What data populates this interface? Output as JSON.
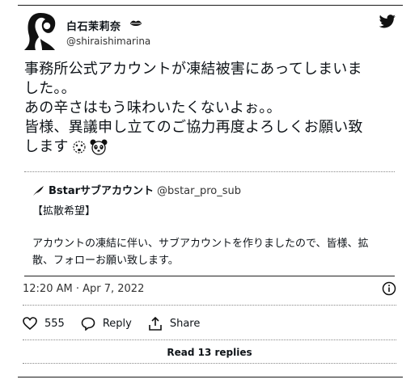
{
  "user": {
    "name": "白石茉莉奈",
    "handle": "@shiraishimarina"
  },
  "tweet": {
    "lines": [
      "事務所公式アカウントが凍結被害にあってしまいま",
      "した。。",
      "あの辛さはもう味わいたくないよぉ。。",
      "皆様、異議申し立てのご協力再度よろしくお願い致",
      "します"
    ]
  },
  "quote": {
    "name": "Bstarサブアカウント",
    "handle": "@bstar_pro_sub",
    "tag": "【拡散希望】",
    "body": "アカウントの凍結に伴い、サブアカウントを作りましたので、皆様、拡散、フォローお願い致します。"
  },
  "timestamp": "12:20 AM · Apr 7, 2022",
  "actions": {
    "likes": "555",
    "reply": "Reply",
    "share": "Share"
  },
  "replies_link": "Read 13 replies",
  "icons": {
    "avatar": "avatar-illustration",
    "verified": "lips-icon",
    "platform": "twitter-bird-icon",
    "info": "info-icon",
    "like": "heart-icon",
    "reply": "speech-bubble-icon",
    "share": "share-upload-icon",
    "quote_logo": "feather-icon",
    "emoji_1": "dizzy-face-icon",
    "emoji_2": "panda-face-icon"
  }
}
